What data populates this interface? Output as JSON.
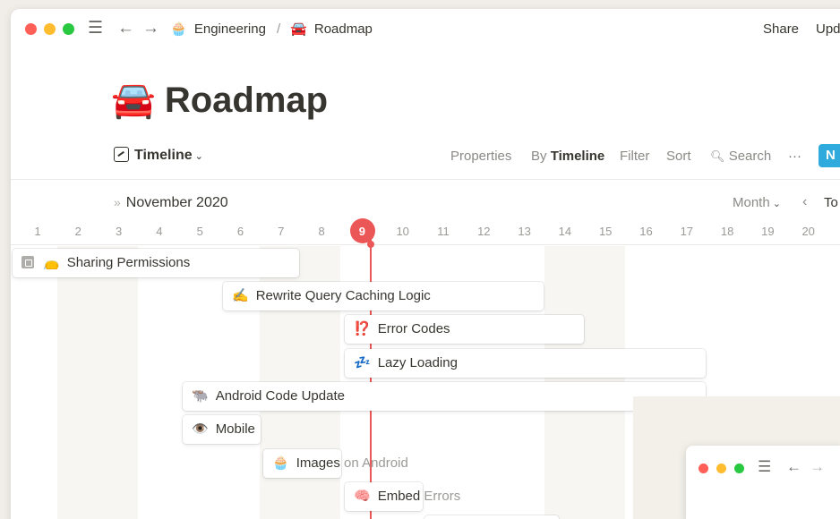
{
  "window": {
    "traffic_lights": {
      "close": "#ff5f57",
      "minimize": "#febc2e",
      "maximize": "#28c840"
    },
    "menu_icon": "hamburger-icon",
    "back_icon": "arrow-left-icon",
    "forward_icon": "arrow-right-icon"
  },
  "breadcrumb": {
    "parent_emoji": "🧁",
    "parent": "Engineering",
    "separator": "/",
    "current_emoji": "🚘",
    "current": "Roadmap"
  },
  "top_actions": {
    "share": "Share",
    "updates": "Upd"
  },
  "page": {
    "emoji": "🚘",
    "title": "Roadmap"
  },
  "view_bar": {
    "view_name": "Timeline",
    "properties": "Properties",
    "group_prefix": "By",
    "group_value": "Timeline",
    "filter": "Filter",
    "sort": "Sort",
    "search": "Search",
    "more": "···",
    "new_button": "N"
  },
  "timeline": {
    "month": "November 2020",
    "scale": "Month",
    "today_label": "To",
    "current_day": 9,
    "days": [
      "1",
      "2",
      "3",
      "4",
      "5",
      "6",
      "7",
      "8",
      "9",
      "10",
      "11",
      "12",
      "13",
      "14",
      "15",
      "16",
      "17",
      "18",
      "19",
      "20"
    ],
    "accent_color": "#eb5757"
  },
  "tasks": [
    {
      "emoji": "👝",
      "title": "Sharing Permissions",
      "collapsible": true
    },
    {
      "emoji": "✍️",
      "title": "Rewrite Query Caching Logic"
    },
    {
      "emoji": "⁉️",
      "title": "Error Codes"
    },
    {
      "emoji": "💤",
      "title": "Lazy Loading"
    },
    {
      "emoji": "🐃",
      "title": "Android Code Update"
    },
    {
      "emoji": "👁️",
      "title": "Mobile"
    },
    {
      "emoji": "🧁",
      "title": "Images",
      "overflow": " on Android"
    },
    {
      "emoji": "🧠",
      "title": "Embed",
      "overflow": " Errors"
    }
  ],
  "mini_window": {
    "traffic_lights": {
      "close": "#ff5f57",
      "minimize": "#febc2e",
      "maximize": "#28c840"
    }
  }
}
